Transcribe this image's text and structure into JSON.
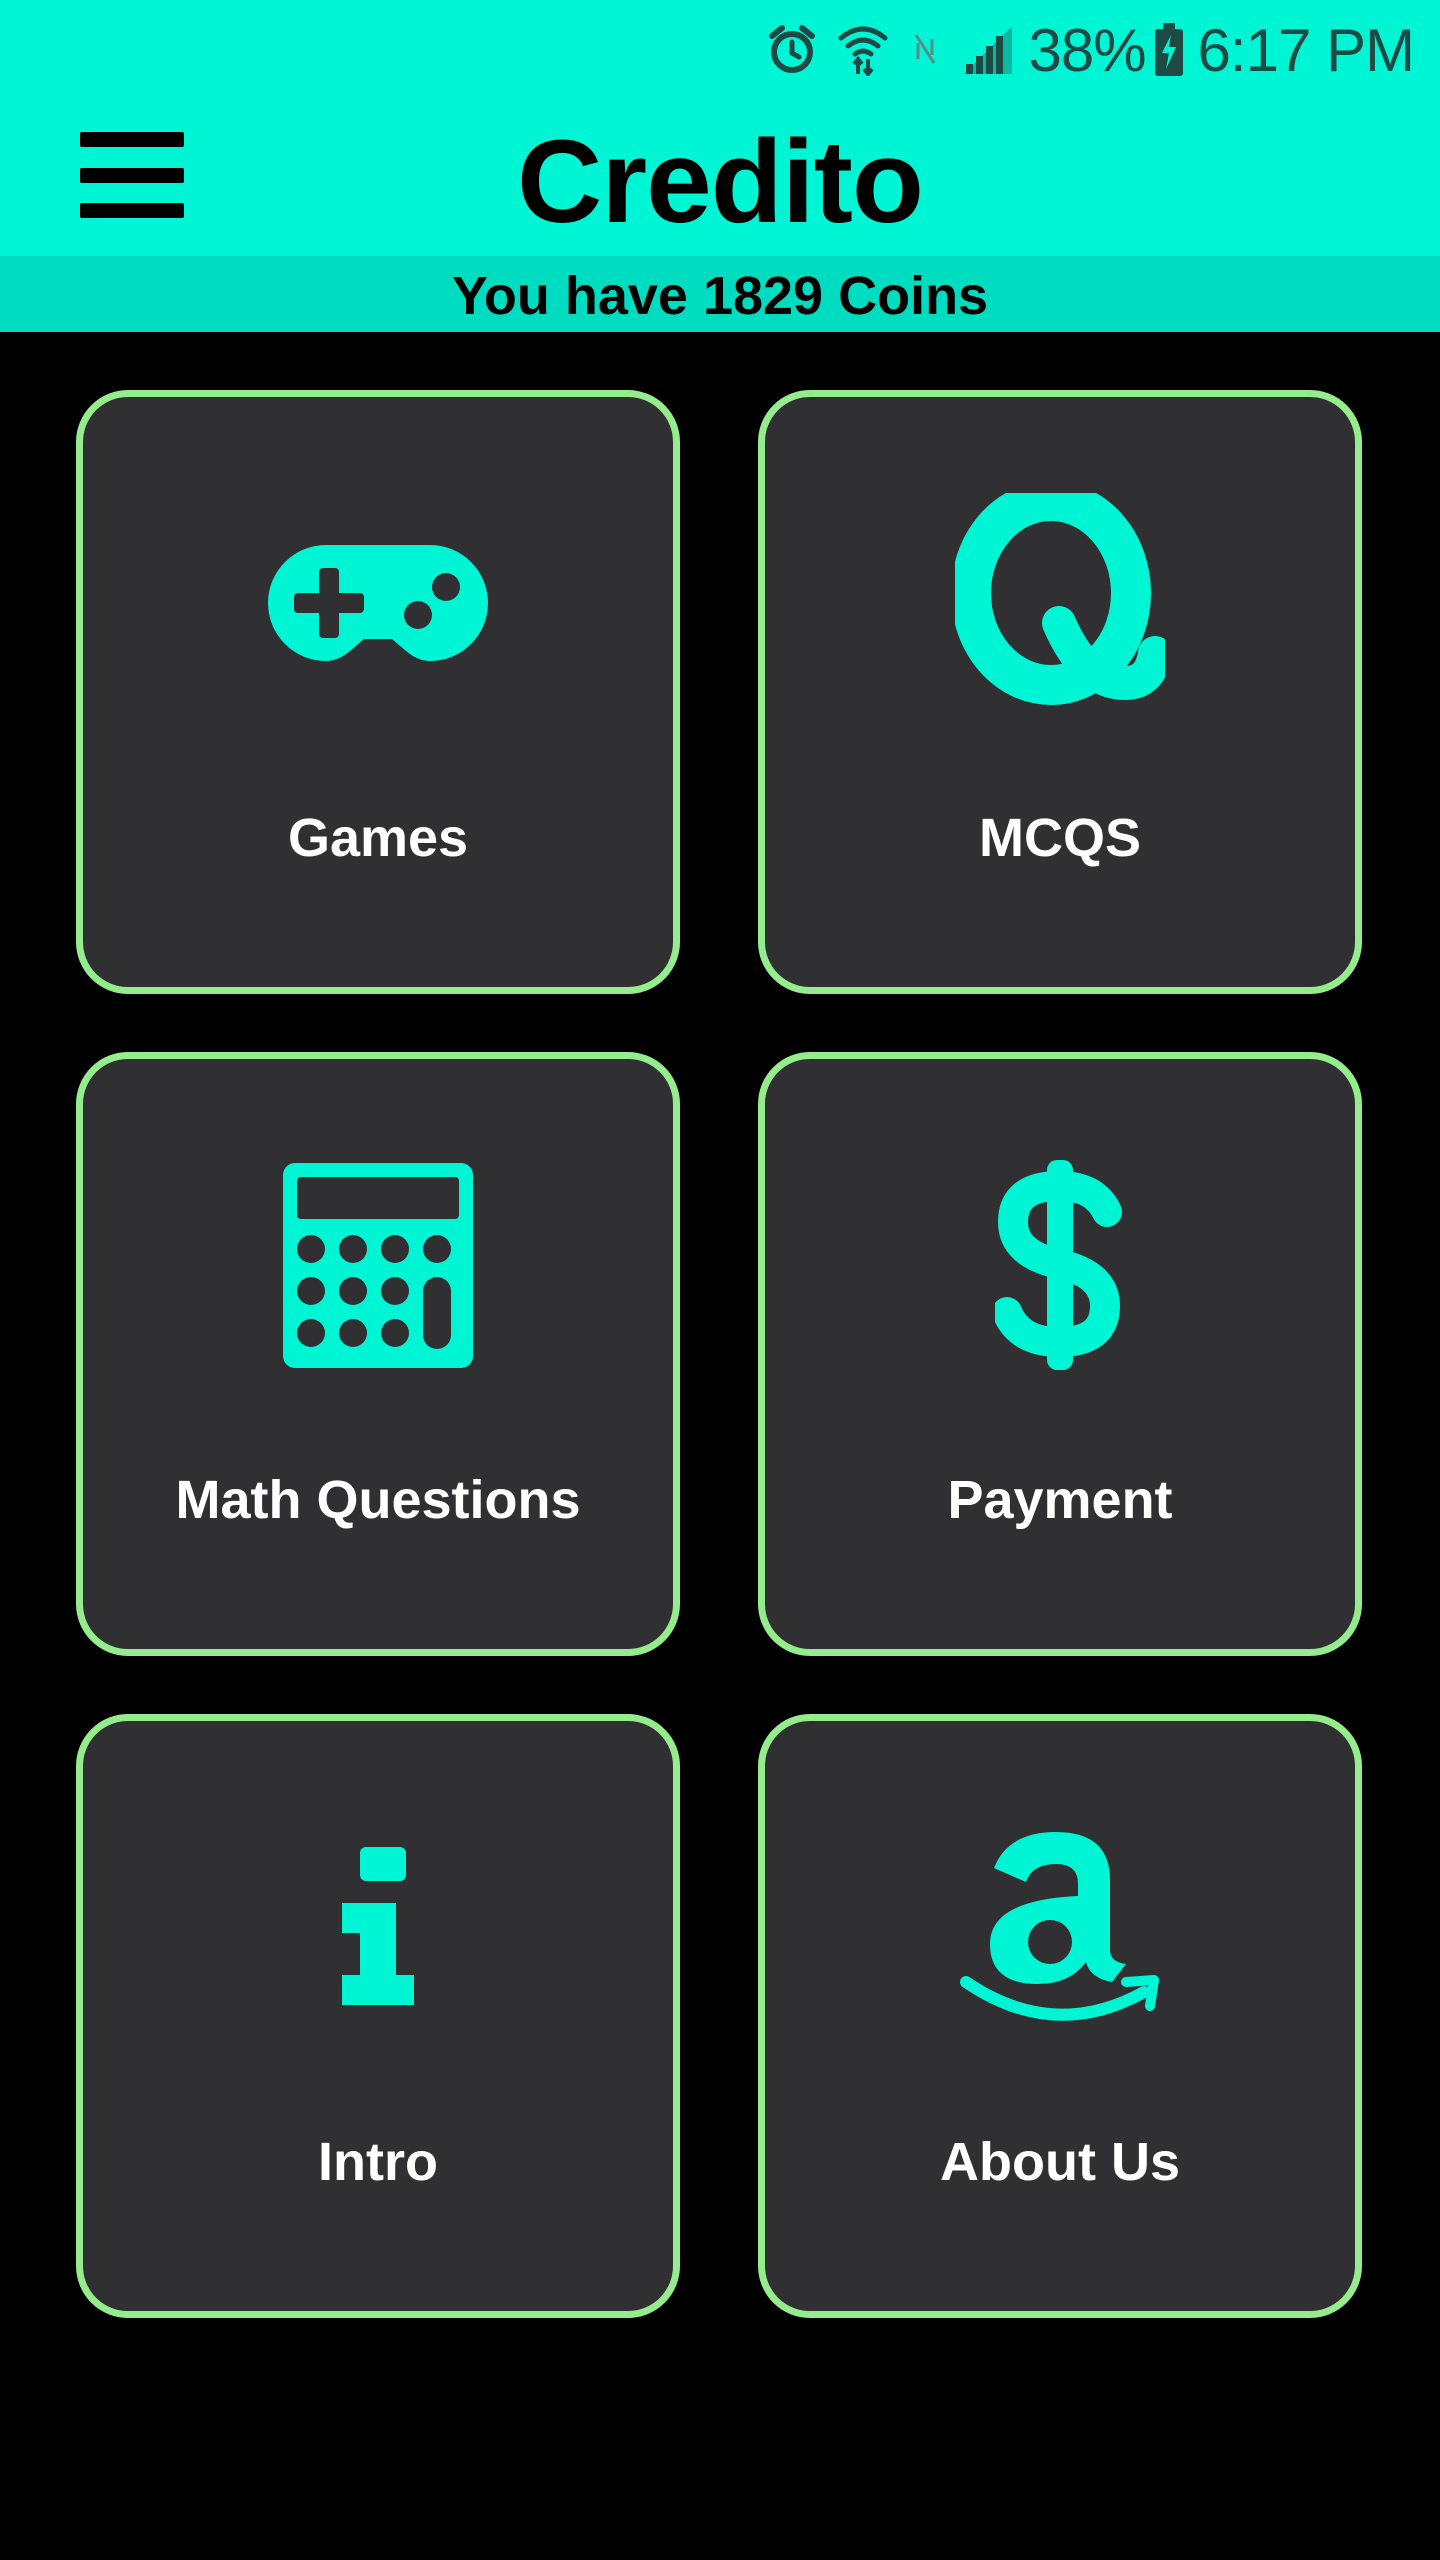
{
  "status_bar": {
    "battery_percent": "38%",
    "time": "6:17 PM",
    "icons": [
      "alarm-icon",
      "wifi-icon",
      "no-sim-icon",
      "signal-icon",
      "battery-charging-icon"
    ]
  },
  "app_bar": {
    "title": "Credito",
    "menu_icon": "hamburger-menu-icon"
  },
  "coins": {
    "text": "You have 1829 Coins"
  },
  "tiles": [
    {
      "label": "Games",
      "icon": "gamepad-icon"
    },
    {
      "label": "MCQS",
      "icon": "q-letter-icon"
    },
    {
      "label": "Math Questions",
      "icon": "calculator-icon"
    },
    {
      "label": "Payment",
      "icon": "dollar-icon"
    },
    {
      "label": "Intro",
      "icon": "info-icon"
    },
    {
      "label": "About Us",
      "icon": "amazon-icon"
    }
  ],
  "colors": {
    "accent": "#00f5d4",
    "coin_bar": "#00dcc0",
    "tile_bg": "#303033",
    "tile_border": "#95ec8d",
    "background": "#000000"
  }
}
